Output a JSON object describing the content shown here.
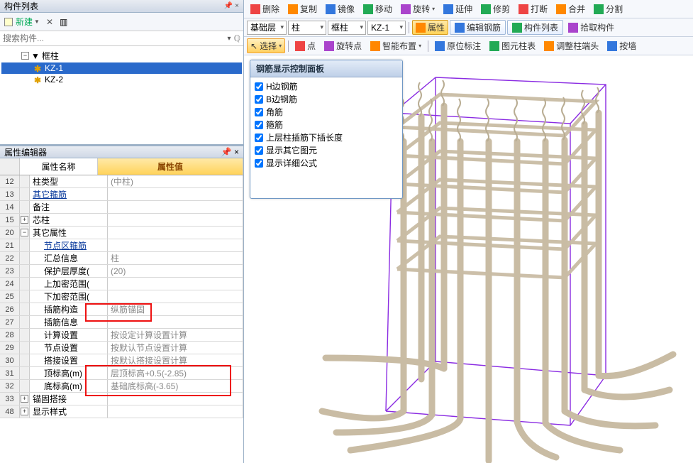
{
  "left": {
    "component_list_title": "构件列表",
    "new_btn": "新建",
    "search_placeholder": "搜索构件...",
    "tree": {
      "root": "框柱",
      "kz1": "KZ-1",
      "kz2": "KZ-2"
    },
    "prop_editor_title": "属性编辑器",
    "prop_header_name": "属性名称",
    "prop_header_value": "属性值",
    "rows": [
      {
        "n": "12",
        "name": "柱类型",
        "val": "(中柱)"
      },
      {
        "n": "13",
        "name": "其它箍筋",
        "val": "",
        "blue": true
      },
      {
        "n": "14",
        "name": "备注",
        "val": ""
      },
      {
        "n": "15",
        "name": "芯柱",
        "val": "",
        "group": true,
        "exp": "+"
      },
      {
        "n": "20",
        "name": "其它属性",
        "val": "",
        "group": true,
        "exp": "−"
      },
      {
        "n": "21",
        "name": "节点区箍筋",
        "val": "",
        "blue": true,
        "indent": true
      },
      {
        "n": "22",
        "name": "汇总信息",
        "val": "柱",
        "indent": true
      },
      {
        "n": "23",
        "name": "保护层厚度(",
        "val": "(20)",
        "indent": true
      },
      {
        "n": "24",
        "name": "上加密范围(",
        "val": "",
        "indent": true
      },
      {
        "n": "25",
        "name": "下加密范围(",
        "val": "",
        "indent": true
      },
      {
        "n": "26",
        "name": "插筋构造",
        "val": "纵筋锚固",
        "indent": true
      },
      {
        "n": "27",
        "name": "插筋信息",
        "val": "",
        "indent": true
      },
      {
        "n": "28",
        "name": "计算设置",
        "val": "按设定计算设置计算",
        "indent": true
      },
      {
        "n": "29",
        "name": "节点设置",
        "val": "按默认节点设置计算",
        "indent": true
      },
      {
        "n": "30",
        "name": "搭接设置",
        "val": "按默认搭接设置计算",
        "indent": true
      },
      {
        "n": "31",
        "name": "顶标高(m)",
        "val": "层顶标高+0.5(-2.85)",
        "indent": true
      },
      {
        "n": "32",
        "name": "底标高(m)",
        "val": "基础底标高(-3.65)",
        "indent": true
      },
      {
        "n": "33",
        "name": "锚固搭接",
        "val": "",
        "group": true,
        "exp": "+"
      },
      {
        "n": "48",
        "name": "显示样式",
        "val": "",
        "group": true,
        "exp": "+"
      }
    ]
  },
  "top1": {
    "delete": "删除",
    "copy": "复制",
    "mirror": "镜像",
    "move": "移动",
    "rotate": "旋转",
    "extend": "延伸",
    "trim": "修剪",
    "break": "打断",
    "merge": "合并",
    "split": "分割"
  },
  "top2": {
    "floor": "基础层",
    "el1": "柱",
    "el2": "框柱",
    "el3": "KZ-1",
    "props": "属性",
    "editrebar": "编辑钢筋",
    "complist": "构件列表",
    "pickcomp": "拾取构件"
  },
  "top3": {
    "select": "选择",
    "point": "点",
    "rotpoint": "旋转点",
    "smartplace": "智能布置",
    "origmark": "原位标注",
    "eltable": "图元柱表",
    "adjhead": "调整柱端头",
    "bybutton": "按墙"
  },
  "floatpanel": {
    "title": "钢筋显示控制面板",
    "items": [
      "H边钢筋",
      "B边钢筋",
      "角筋",
      "箍筋",
      "上层柱插筋下插长度",
      "显示其它图元",
      "显示详细公式"
    ]
  }
}
